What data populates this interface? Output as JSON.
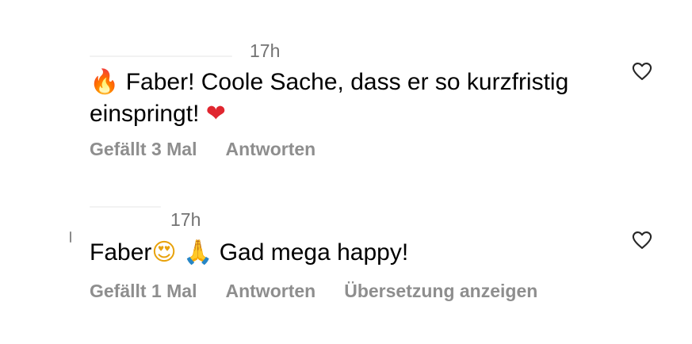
{
  "comments": [
    {
      "time": "17h",
      "lead_emoji": "🔥",
      "text_line1": "Faber! Coole Sache, dass er so kurzfristig",
      "text_line2": "einspringt!",
      "trail_emoji": "❤",
      "likes": "Gefällt 3 Mal",
      "reply": "Antworten"
    },
    {
      "time": "17h",
      "text_before": "Faber",
      "emoji1": "😍",
      "emoji2": "🙏",
      "text_after": "Gad mega happy!",
      "likes": "Gefällt 1 Mal",
      "reply": "Antworten",
      "translate": "Übersetzung anzeigen"
    }
  ],
  "icons": {
    "like": "heart-outline-icon",
    "colors": {
      "text": "#000000",
      "secondary": "#8e8e8e",
      "timestamp": "#737373",
      "heart_emoji": "#e0262f"
    }
  }
}
